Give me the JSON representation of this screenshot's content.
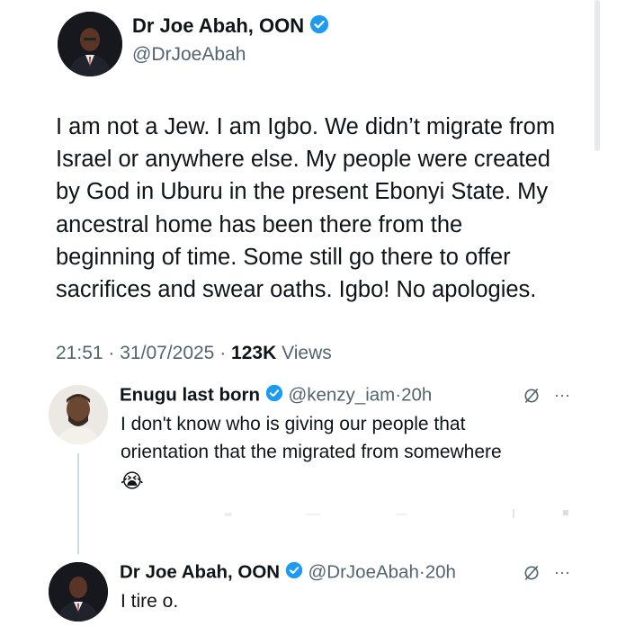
{
  "main_tweet": {
    "author_name": "Dr Joe Abah, OON",
    "handle": "@DrJoeAbah",
    "text": "I am not a Jew. I am Igbo. We didn’t migrate from\nIsrael or anywhere else. My people were created\nby God in Uburu in the present Ebonyi State. My\nancestral home has been there from the\nbeginning of time. Some still go there to offer\nsacrifices and swear oaths. Igbo! No apologies.",
    "time": "21:51",
    "date": "31/07/2025",
    "views_count": "123K",
    "views_label": "Views"
  },
  "replies": [
    {
      "author_name": "Enugu last born",
      "handle": "@kenzy_iam",
      "age": "20h",
      "text": "I don't know who is giving our people that\norientation that the migrated from somewhere",
      "emoji": "😭",
      "more": "···"
    },
    {
      "author_name": "Dr Joe Abah, OON",
      "handle": "@DrJoeAbah",
      "age": "20h",
      "text": "I tire o.",
      "more": "···"
    }
  ],
  "separator": "·",
  "colors": {
    "verified": "#1d9bf0",
    "secondary_text": "#536471",
    "primary_text": "#0f1419"
  },
  "icons": [
    "verified-badge-icon",
    "grok-icon",
    "more-icon"
  ]
}
